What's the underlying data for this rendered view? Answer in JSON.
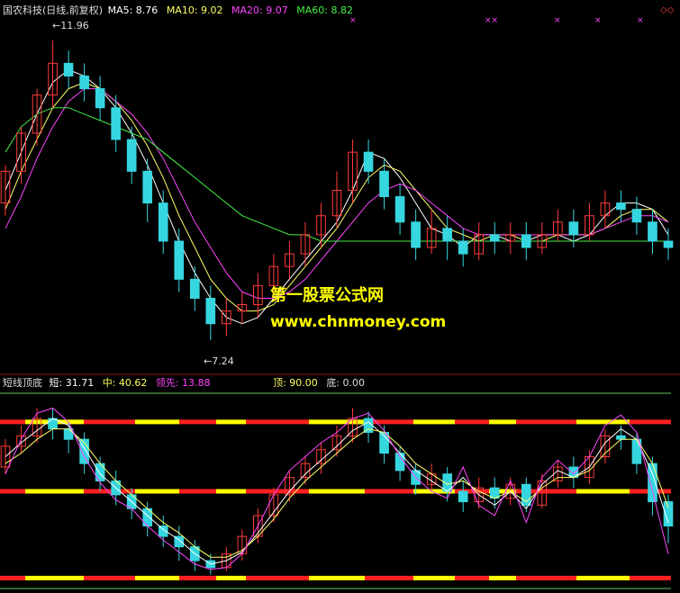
{
  "header_top": {
    "name": "国农科技(日线,前复权)",
    "ma5": "MA5: 8.76",
    "ma10": "MA10: 9.02",
    "ma20": "MA20: 9.07",
    "ma60": "MA60: 8.82",
    "corner_icon": "double-diamond-icon"
  },
  "price_labels": {
    "high": "11.96",
    "low": "7.24"
  },
  "watermark": {
    "line1": "第一股票公式网",
    "line2": "www.chnmoney.com"
  },
  "header_bottom": {
    "name": "短线顶底",
    "short": "短: 31.71",
    "mid": "中: 40.62",
    "lead": "领先: 13.88",
    "top": "顶: 90.00",
    "bottom": "底: 0.00"
  },
  "colors": {
    "background": "#000000",
    "up_candle": "#ff3b3b",
    "down_candle": "#36d6e0",
    "ma5": "#ffffff",
    "ma10": "#ffff66",
    "ma20": "#ff44ff",
    "ma60": "#44ee44",
    "level_yellow": "#ffff00",
    "level_red": "#ff2020"
  },
  "chart_data": [
    {
      "type": "candlestick",
      "title": "国农科技(日线,前复权)",
      "series": [
        {
          "name": "MA5",
          "values": [
            9.6,
            10.2,
            10.8,
            11.3,
            11.5,
            11.4,
            11.2,
            10.9,
            10.5,
            10.0,
            9.4,
            8.8,
            8.3,
            7.9,
            7.6,
            7.5,
            7.6,
            7.9,
            8.2,
            8.5,
            8.8,
            9.1,
            9.6,
            10.2,
            10.1,
            9.8,
            9.4,
            9.0,
            8.9,
            8.7,
            8.9,
            8.9,
            8.8,
            8.8,
            8.9,
            8.9,
            8.8,
            8.9,
            9.2,
            9.4,
            9.4,
            9.3,
            8.9
          ]
        },
        {
          "name": "MA10",
          "values": [
            9.3,
            9.9,
            10.4,
            10.9,
            11.2,
            11.3,
            11.2,
            11.0,
            10.7,
            10.3,
            9.8,
            9.2,
            8.7,
            8.2,
            7.9,
            7.7,
            7.7,
            7.8,
            8.1,
            8.4,
            8.7,
            9.0,
            9.4,
            9.8,
            10.0,
            9.9,
            9.6,
            9.3,
            9.0,
            8.9,
            8.8,
            8.9,
            8.9,
            8.8,
            8.8,
            8.9,
            8.9,
            8.9,
            9.0,
            9.2,
            9.3,
            9.3,
            9.1
          ]
        },
        {
          "name": "MA20",
          "values": [
            9.0,
            9.5,
            10.1,
            10.6,
            11.0,
            11.2,
            11.2,
            11.0,
            10.8,
            10.5,
            10.1,
            9.6,
            9.1,
            8.7,
            8.3,
            8.0,
            7.9,
            7.9,
            8.0,
            8.2,
            8.5,
            8.8,
            9.1,
            9.4,
            9.6,
            9.7,
            9.6,
            9.4,
            9.2,
            9.0,
            8.9,
            8.9,
            8.9,
            8.9,
            8.9,
            8.9,
            8.9,
            8.9,
            9.0,
            9.1,
            9.2,
            9.2,
            9.1
          ]
        },
        {
          "name": "MA60",
          "values": [
            10.2,
            10.6,
            10.8,
            10.9,
            10.9,
            10.8,
            10.7,
            10.6,
            10.5,
            10.4,
            10.2,
            10.0,
            9.8,
            9.6,
            9.4,
            9.2,
            9.1,
            9.0,
            8.9,
            8.9,
            8.8,
            8.8,
            8.8,
            8.8,
            8.8,
            8.8,
            8.8,
            8.8,
            8.8,
            8.8,
            8.8,
            8.8,
            8.8,
            8.8,
            8.8,
            8.8,
            8.8,
            8.8,
            8.8,
            8.8,
            8.8,
            8.8,
            8.8
          ]
        }
      ],
      "candles": [
        [
          9.4,
          9.9,
          10.0,
          9.2
        ],
        [
          9.9,
          10.5,
          10.6,
          9.7
        ],
        [
          10.5,
          11.1,
          11.2,
          10.3
        ],
        [
          11.1,
          11.6,
          11.96,
          10.9
        ],
        [
          11.6,
          11.4,
          11.8,
          11.2
        ],
        [
          11.4,
          11.2,
          11.6,
          11.0
        ],
        [
          11.2,
          10.9,
          11.4,
          10.7
        ],
        [
          10.9,
          10.4,
          11.1,
          10.2
        ],
        [
          10.4,
          9.9,
          10.6,
          9.7
        ],
        [
          9.9,
          9.4,
          10.1,
          9.1
        ],
        [
          9.4,
          8.8,
          9.6,
          8.6
        ],
        [
          8.8,
          8.2,
          9.0,
          8.0
        ],
        [
          8.2,
          7.9,
          8.4,
          7.7
        ],
        [
          7.9,
          7.5,
          8.1,
          7.24
        ],
        [
          7.5,
          7.7,
          7.9,
          7.3
        ],
        [
          7.7,
          7.8,
          8.0,
          7.5
        ],
        [
          7.8,
          8.1,
          8.3,
          7.6
        ],
        [
          8.1,
          8.4,
          8.6,
          7.9
        ],
        [
          8.4,
          8.6,
          8.8,
          8.2
        ],
        [
          8.6,
          8.9,
          9.1,
          8.4
        ],
        [
          8.9,
          9.2,
          9.4,
          8.7
        ],
        [
          9.2,
          9.6,
          9.9,
          9.0
        ],
        [
          9.6,
          10.2,
          10.4,
          9.4
        ],
        [
          10.2,
          9.9,
          10.4,
          9.7
        ],
        [
          9.9,
          9.5,
          10.1,
          9.3
        ],
        [
          9.5,
          9.1,
          9.7,
          8.9
        ],
        [
          9.1,
          8.7,
          9.3,
          8.5
        ],
        [
          8.7,
          9.0,
          9.3,
          8.6
        ],
        [
          9.0,
          8.8,
          9.2,
          8.5
        ],
        [
          8.8,
          8.6,
          9.0,
          8.4
        ],
        [
          8.6,
          8.9,
          9.1,
          8.5
        ],
        [
          8.9,
          8.8,
          9.1,
          8.6
        ],
        [
          8.8,
          8.9,
          9.1,
          8.6
        ],
        [
          8.9,
          8.7,
          9.1,
          8.5
        ],
        [
          8.7,
          8.9,
          9.1,
          8.6
        ],
        [
          8.9,
          9.1,
          9.3,
          8.8
        ],
        [
          9.1,
          8.9,
          9.3,
          8.7
        ],
        [
          8.9,
          9.2,
          9.4,
          8.8
        ],
        [
          9.2,
          9.4,
          9.6,
          9.0
        ],
        [
          9.4,
          9.3,
          9.6,
          9.1
        ],
        [
          9.3,
          9.1,
          9.5,
          8.9
        ],
        [
          9.1,
          8.8,
          9.3,
          8.6
        ],
        [
          8.8,
          8.7,
          9.0,
          8.5
        ]
      ],
      "ylim": [
        7.0,
        12.2
      ],
      "annotations": [
        "11.96",
        "7.24"
      ]
    },
    {
      "type": "candlestick",
      "title": "短线顶底",
      "levels": [
        90,
        50,
        0
      ],
      "series": [
        {
          "name": "短",
          "values": [
            70,
            78,
            85,
            92,
            88,
            75,
            60,
            52,
            44,
            36,
            28,
            22,
            14,
            8,
            10,
            15,
            26,
            38,
            50,
            60,
            68,
            76,
            85,
            90,
            82,
            72,
            62,
            56,
            50,
            58,
            48,
            42,
            50,
            40,
            54,
            62,
            58,
            64,
            78,
            86,
            80,
            60,
            31.71
          ]
        },
        {
          "name": "中",
          "values": [
            66,
            72,
            80,
            86,
            86,
            78,
            66,
            56,
            48,
            40,
            32,
            26,
            18,
            12,
            12,
            16,
            24,
            34,
            46,
            56,
            64,
            72,
            80,
            86,
            84,
            76,
            66,
            60,
            54,
            56,
            50,
            46,
            50,
            44,
            52,
            58,
            58,
            62,
            72,
            80,
            80,
            66,
            40.62
          ]
        },
        {
          "name": "领先",
          "values": [
            60,
            80,
            95,
            98,
            90,
            70,
            55,
            45,
            40,
            30,
            22,
            15,
            8,
            5,
            6,
            14,
            30,
            48,
            62,
            70,
            78,
            84,
            92,
            95,
            85,
            70,
            58,
            50,
            46,
            64,
            42,
            36,
            56,
            32,
            58,
            68,
            60,
            70,
            88,
            94,
            84,
            50,
            13.88
          ]
        }
      ],
      "candles": [
        [
          64,
          76,
          80,
          60
        ],
        [
          76,
          82,
          88,
          72
        ],
        [
          82,
          92,
          98,
          78
        ],
        [
          92,
          86,
          98,
          80
        ],
        [
          86,
          80,
          90,
          72
        ],
        [
          80,
          66,
          84,
          60
        ],
        [
          66,
          56,
          70,
          50
        ],
        [
          56,
          48,
          62,
          42
        ],
        [
          48,
          40,
          52,
          34
        ],
        [
          40,
          30,
          44,
          24
        ],
        [
          30,
          24,
          36,
          18
        ],
        [
          24,
          18,
          30,
          10
        ],
        [
          18,
          10,
          22,
          4
        ],
        [
          10,
          6,
          14,
          2
        ],
        [
          6,
          14,
          18,
          4
        ],
        [
          14,
          24,
          28,
          10
        ],
        [
          24,
          36,
          40,
          20
        ],
        [
          36,
          48,
          52,
          32
        ],
        [
          48,
          58,
          62,
          44
        ],
        [
          58,
          66,
          70,
          54
        ],
        [
          66,
          74,
          78,
          60
        ],
        [
          74,
          82,
          88,
          70
        ],
        [
          82,
          92,
          98,
          78
        ],
        [
          92,
          84,
          96,
          78
        ],
        [
          84,
          72,
          88,
          66
        ],
        [
          72,
          62,
          76,
          56
        ],
        [
          62,
          54,
          66,
          48
        ],
        [
          54,
          60,
          66,
          50
        ],
        [
          60,
          50,
          64,
          44
        ],
        [
          50,
          44,
          56,
          38
        ],
        [
          44,
          52,
          58,
          40
        ],
        [
          52,
          46,
          58,
          40
        ],
        [
          46,
          54,
          58,
          42
        ],
        [
          54,
          42,
          58,
          38
        ],
        [
          42,
          56,
          60,
          40
        ],
        [
          56,
          64,
          68,
          52
        ],
        [
          64,
          58,
          70,
          52
        ],
        [
          58,
          70,
          74,
          54
        ],
        [
          70,
          82,
          86,
          66
        ],
        [
          82,
          80,
          88,
          74
        ],
        [
          80,
          66,
          84,
          60
        ],
        [
          66,
          44,
          70,
          36
        ],
        [
          44,
          30,
          48,
          20
        ]
      ],
      "ylim": [
        -5,
        105
      ]
    }
  ]
}
